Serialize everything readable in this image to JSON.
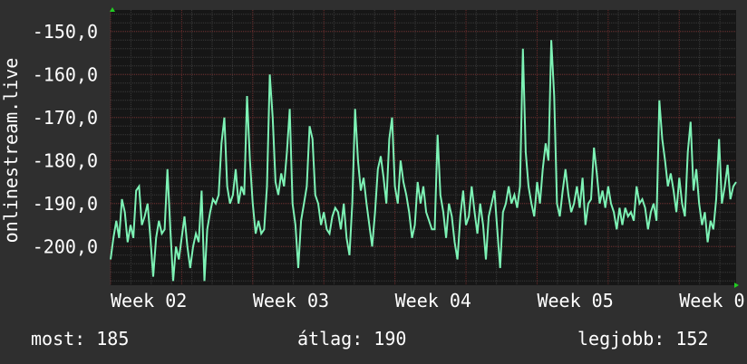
{
  "chart_data": {
    "type": "line",
    "ylabel": "onlinestream.live",
    "y_ticks": [
      "-150,0",
      "-160,0",
      "-170,0",
      "-180,0",
      "-190,0",
      "-200,0"
    ],
    "y_tick_values": [
      -150,
      -160,
      -170,
      -180,
      -190,
      -200
    ],
    "ylim": [
      -209,
      -145
    ],
    "x_ticks": [
      "Week 02",
      "Week 03",
      "Week 04",
      "Week 05",
      "Week 0"
    ],
    "x_tick_values": [
      2,
      3,
      4,
      5,
      6
    ],
    "xlim": [
      2,
      6.4
    ],
    "grid": true,
    "line_color": "#7df2b5",
    "background_color": "#161616",
    "grid_major_color": "#6a2a2a",
    "grid_minor_color": "#3a3a3a",
    "series": [
      {
        "values": [
          [
            2.0,
            -203
          ],
          [
            2.02,
            -198
          ],
          [
            2.04,
            -194
          ],
          [
            2.06,
            -198
          ],
          [
            2.08,
            -189
          ],
          [
            2.1,
            -192
          ],
          [
            2.12,
            -199
          ],
          [
            2.14,
            -195
          ],
          [
            2.16,
            -198
          ],
          [
            2.18,
            -187
          ],
          [
            2.2,
            -186
          ],
          [
            2.22,
            -195
          ],
          [
            2.24,
            -193
          ],
          [
            2.26,
            -190
          ],
          [
            2.28,
            -198
          ],
          [
            2.3,
            -207
          ],
          [
            2.32,
            -198
          ],
          [
            2.34,
            -194
          ],
          [
            2.36,
            -197
          ],
          [
            2.38,
            -196
          ],
          [
            2.4,
            -182
          ],
          [
            2.42,
            -196
          ],
          [
            2.44,
            -208
          ],
          [
            2.46,
            -200
          ],
          [
            2.48,
            -203
          ],
          [
            2.5,
            -198
          ],
          [
            2.52,
            -193
          ],
          [
            2.54,
            -200
          ],
          [
            2.56,
            -205
          ],
          [
            2.58,
            -200
          ],
          [
            2.6,
            -197
          ],
          [
            2.62,
            -199
          ],
          [
            2.64,
            -187
          ],
          [
            2.66,
            -208
          ],
          [
            2.68,
            -196
          ],
          [
            2.7,
            -192
          ],
          [
            2.72,
            -189
          ],
          [
            2.74,
            -190
          ],
          [
            2.76,
            -188
          ],
          [
            2.78,
            -176
          ],
          [
            2.8,
            -170
          ],
          [
            2.82,
            -186
          ],
          [
            2.84,
            -190
          ],
          [
            2.86,
            -188
          ],
          [
            2.88,
            -182
          ],
          [
            2.9,
            -190
          ],
          [
            2.92,
            -186
          ],
          [
            2.94,
            -188
          ],
          [
            2.96,
            -165
          ],
          [
            2.98,
            -180
          ],
          [
            3.0,
            -190
          ],
          [
            3.02,
            -197
          ],
          [
            3.04,
            -194
          ],
          [
            3.06,
            -197
          ],
          [
            3.08,
            -196
          ],
          [
            3.1,
            -186
          ],
          [
            3.12,
            -160
          ],
          [
            3.14,
            -170
          ],
          [
            3.16,
            -185
          ],
          [
            3.18,
            -188
          ],
          [
            3.2,
            -183
          ],
          [
            3.22,
            -186
          ],
          [
            3.24,
            -178
          ],
          [
            3.26,
            -168
          ],
          [
            3.28,
            -190
          ],
          [
            3.3,
            -195
          ],
          [
            3.32,
            -205
          ],
          [
            3.34,
            -194
          ],
          [
            3.36,
            -190
          ],
          [
            3.38,
            -186
          ],
          [
            3.4,
            -172
          ],
          [
            3.42,
            -175
          ],
          [
            3.44,
            -188
          ],
          [
            3.46,
            -190
          ],
          [
            3.48,
            -195
          ],
          [
            3.5,
            -192
          ],
          [
            3.52,
            -196
          ],
          [
            3.54,
            -197
          ],
          [
            3.56,
            -193
          ],
          [
            3.58,
            -191
          ],
          [
            3.6,
            -192
          ],
          [
            3.62,
            -196
          ],
          [
            3.64,
            -190
          ],
          [
            3.66,
            -198
          ],
          [
            3.68,
            -202
          ],
          [
            3.7,
            -190
          ],
          [
            3.72,
            -168
          ],
          [
            3.74,
            -180
          ],
          [
            3.76,
            -187
          ],
          [
            3.78,
            -184
          ],
          [
            3.8,
            -190
          ],
          [
            3.82,
            -195
          ],
          [
            3.84,
            -200
          ],
          [
            3.86,
            -192
          ],
          [
            3.88,
            -182
          ],
          [
            3.9,
            -179
          ],
          [
            3.92,
            -184
          ],
          [
            3.94,
            -190
          ],
          [
            3.96,
            -175
          ],
          [
            3.98,
            -170
          ],
          [
            4.0,
            -186
          ],
          [
            4.02,
            -190
          ],
          [
            4.04,
            -180
          ],
          [
            4.06,
            -185
          ],
          [
            4.08,
            -188
          ],
          [
            4.1,
            -192
          ],
          [
            4.12,
            -198
          ],
          [
            4.14,
            -195
          ],
          [
            4.16,
            -185
          ],
          [
            4.18,
            -190
          ],
          [
            4.2,
            -186
          ],
          [
            4.22,
            -192
          ],
          [
            4.24,
            -194
          ],
          [
            4.26,
            -196
          ],
          [
            4.28,
            -196
          ],
          [
            4.3,
            -174
          ],
          [
            4.32,
            -188
          ],
          [
            4.34,
            -192
          ],
          [
            4.36,
            -198
          ],
          [
            4.38,
            -190
          ],
          [
            4.4,
            -193
          ],
          [
            4.42,
            -199
          ],
          [
            4.44,
            -203
          ],
          [
            4.46,
            -193
          ],
          [
            4.48,
            -187
          ],
          [
            4.5,
            -195
          ],
          [
            4.52,
            -193
          ],
          [
            4.54,
            -186
          ],
          [
            4.56,
            -192
          ],
          [
            4.58,
            -197
          ],
          [
            4.6,
            -190
          ],
          [
            4.62,
            -195
          ],
          [
            4.64,
            -203
          ],
          [
            4.66,
            -193
          ],
          [
            4.68,
            -190
          ],
          [
            4.7,
            -187
          ],
          [
            4.72,
            -196
          ],
          [
            4.74,
            -205
          ],
          [
            4.76,
            -192
          ],
          [
            4.78,
            -190
          ],
          [
            4.8,
            -186
          ],
          [
            4.82,
            -190
          ],
          [
            4.84,
            -188
          ],
          [
            4.86,
            -191
          ],
          [
            4.88,
            -186
          ],
          [
            4.9,
            -154
          ],
          [
            4.92,
            -178
          ],
          [
            4.94,
            -186
          ],
          [
            4.96,
            -190
          ],
          [
            4.98,
            -193
          ],
          [
            5.0,
            -185
          ],
          [
            5.02,
            -190
          ],
          [
            5.04,
            -182
          ],
          [
            5.06,
            -176
          ],
          [
            5.08,
            -180
          ],
          [
            5.1,
            -152
          ],
          [
            5.12,
            -165
          ],
          [
            5.14,
            -190
          ],
          [
            5.16,
            -193
          ],
          [
            5.18,
            -187
          ],
          [
            5.2,
            -182
          ],
          [
            5.22,
            -188
          ],
          [
            5.24,
            -192
          ],
          [
            5.26,
            -190
          ],
          [
            5.28,
            -186
          ],
          [
            5.3,
            -191
          ],
          [
            5.32,
            -184
          ],
          [
            5.34,
            -195
          ],
          [
            5.36,
            -190
          ],
          [
            5.38,
            -189
          ],
          [
            5.4,
            -177
          ],
          [
            5.42,
            -183
          ],
          [
            5.44,
            -190
          ],
          [
            5.46,
            -187
          ],
          [
            5.48,
            -191
          ],
          [
            5.5,
            -186
          ],
          [
            5.52,
            -190
          ],
          [
            5.54,
            -192
          ],
          [
            5.56,
            -196
          ],
          [
            5.58,
            -191
          ],
          [
            5.6,
            -195
          ],
          [
            5.62,
            -191
          ],
          [
            5.64,
            -193
          ],
          [
            5.66,
            -192
          ],
          [
            5.68,
            -194
          ],
          [
            5.7,
            -186
          ],
          [
            5.72,
            -190
          ],
          [
            5.74,
            -189
          ],
          [
            5.76,
            -191
          ],
          [
            5.78,
            -196
          ],
          [
            5.8,
            -192
          ],
          [
            5.82,
            -190
          ],
          [
            5.84,
            -194
          ],
          [
            5.86,
            -166
          ],
          [
            5.88,
            -175
          ],
          [
            5.9,
            -180
          ],
          [
            5.92,
            -186
          ],
          [
            5.94,
            -183
          ],
          [
            5.96,
            -187
          ],
          [
            5.98,
            -192
          ],
          [
            6.0,
            -184
          ],
          [
            6.02,
            -190
          ],
          [
            6.04,
            -193
          ],
          [
            6.06,
            -178
          ],
          [
            6.08,
            -171
          ],
          [
            6.1,
            -187
          ],
          [
            6.12,
            -182
          ],
          [
            6.14,
            -190
          ],
          [
            6.16,
            -195
          ],
          [
            6.18,
            -192
          ],
          [
            6.2,
            -199
          ],
          [
            6.22,
            -194
          ],
          [
            6.24,
            -196
          ],
          [
            6.26,
            -189
          ],
          [
            6.28,
            -175
          ],
          [
            6.3,
            -190
          ],
          [
            6.32,
            -186
          ],
          [
            6.34,
            -181
          ],
          [
            6.36,
            -189
          ],
          [
            6.38,
            -186
          ],
          [
            6.4,
            -185
          ]
        ]
      }
    ]
  },
  "footer": {
    "now": "most: 185",
    "avg": "átlag: 190",
    "best": "legjobb: 152"
  }
}
